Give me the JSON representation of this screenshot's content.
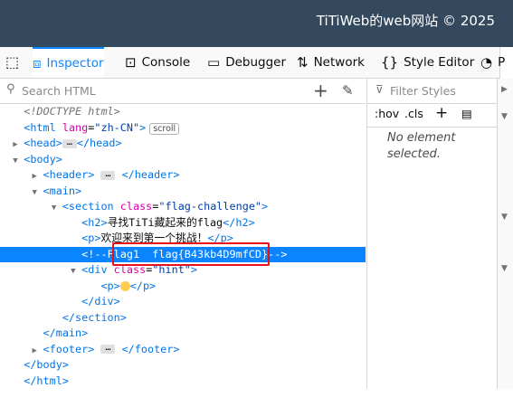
{
  "site": {
    "footer_text": "TiTiWeb的web网站 © 2025"
  },
  "toolbar": {
    "tabs": [
      {
        "label": "Inspector",
        "icon": "inspector-icon"
      },
      {
        "label": "Console",
        "icon": "console-icon"
      },
      {
        "label": "Debugger",
        "icon": "debugger-icon"
      },
      {
        "label": "Network",
        "icon": "network-icon"
      },
      {
        "label": "Style Editor",
        "icon": "style-editor-icon"
      },
      {
        "label": "P",
        "icon": "performance-icon"
      }
    ],
    "selected_tab": "Inspector"
  },
  "markup": {
    "search_placeholder": "Search HTML",
    "lines": {
      "doctype": "<!DOCTYPE html>",
      "html_open_tag": "<html",
      "html_lang_attr": "lang",
      "html_lang_val": "\"zh-CN\"",
      "html_close_bracket": ">",
      "scroll_badge": "scroll",
      "head": "<head>",
      "head_close": "</head>",
      "body": "<body>",
      "header": "<header>",
      "header_close": "</header>",
      "main": "<main>",
      "section_open": "<section",
      "section_attr": "class",
      "section_val": "\"flag-challenge\"",
      "section_bracket": ">",
      "h2_open": "<h2>",
      "h2_text": "寻找TiTi藏起来的flag",
      "h2_close": "</h2>",
      "p_open": "<p>",
      "p_text": "欢迎来到第一个挑战！",
      "p_close": "</p>",
      "comment": "<!--Flag1  flag{B43kb4D9mfCD}-->",
      "div_open": "<div",
      "div_attr": "class",
      "div_val": "\"hint\"",
      "div_bracket": ">",
      "p2_open": "<p>",
      "p2_close": "</p>",
      "div_close": "</div>",
      "section_close": "</section>",
      "main_close": "</main>",
      "footer": "<footer>",
      "footer_close": "</footer>",
      "body_close": "</body>",
      "html_close": "</html>"
    }
  },
  "rules": {
    "filter_placeholder": "Filter Styles",
    "hov": ":hov",
    "cls": ".cls",
    "empty_message": "No element selected."
  },
  "colors": {
    "accent": "#0a84ff",
    "highlight_box": "#e8101b",
    "site_bar": "#34495e"
  }
}
